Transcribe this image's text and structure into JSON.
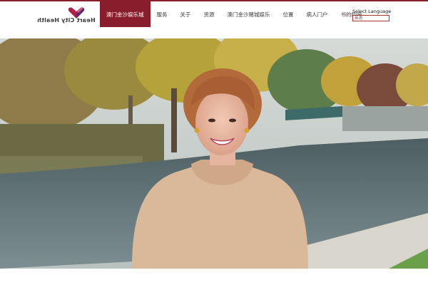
{
  "brand": {
    "name": "Heart City Health"
  },
  "nav": {
    "items": [
      {
        "label": "澳门金沙娱乐城",
        "active": true
      },
      {
        "label": "服务",
        "active": false
      },
      {
        "label": "关于",
        "active": false
      },
      {
        "label": "资源",
        "active": false
      },
      {
        "label": "澳门金沙赌城娱乐",
        "active": false
      },
      {
        "label": "位置",
        "active": false
      },
      {
        "label": "病人门户",
        "active": false
      },
      {
        "label": "书的约会",
        "active": false
      }
    ]
  },
  "language": {
    "label": "Select Language",
    "selected": "英语"
  },
  "colors": {
    "accent": "#8a1d2b",
    "logo_magenta": "#b0204a",
    "logo_purple": "#5a2a7a"
  }
}
